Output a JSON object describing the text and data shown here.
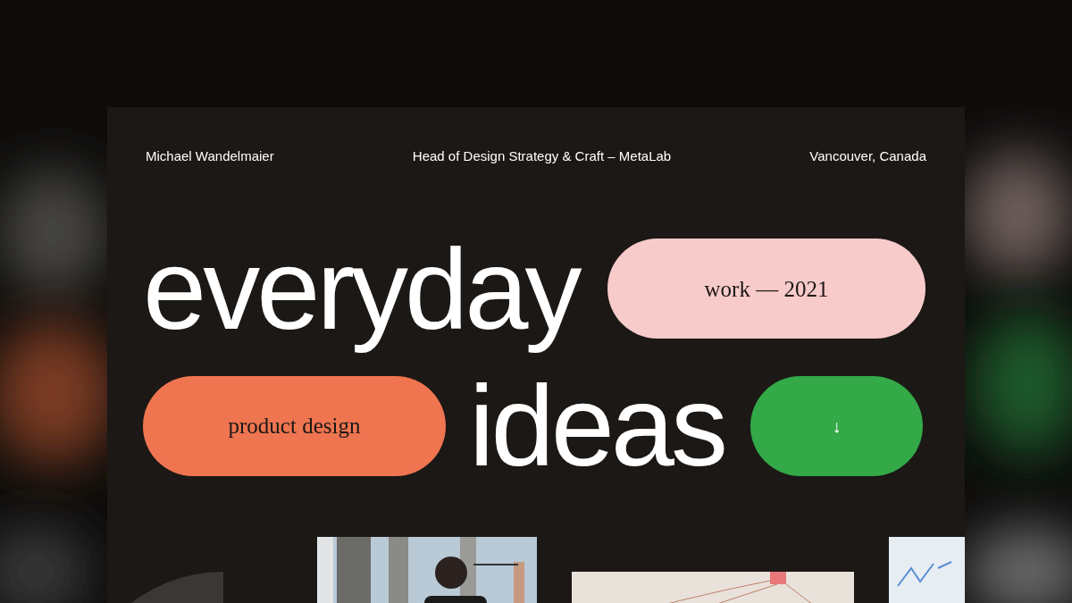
{
  "header": {
    "name": "Michael Wandelmaier",
    "role": "Head of Design Strategy & Craft – MetaLab",
    "location": "Vancouver, Canada"
  },
  "headline": [
    {
      "kind": "word",
      "text": "everyday"
    },
    {
      "kind": "pill",
      "text": "work — 2021",
      "color": "#f8cbcb"
    },
    {
      "kind": "pill",
      "text": "product design",
      "color": "#ef7551"
    },
    {
      "kind": "word",
      "text": "ideas"
    },
    {
      "kind": "button",
      "text": "↓",
      "color": "#33a948"
    }
  ]
}
